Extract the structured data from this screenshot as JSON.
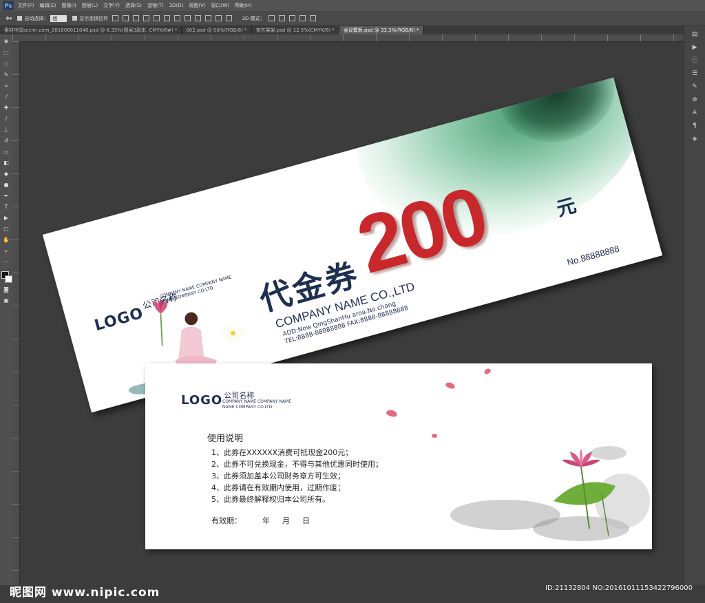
{
  "app": {
    "logo": "Ps"
  },
  "menu": [
    "文件(F)",
    "编辑(E)",
    "图像(I)",
    "图层(L)",
    "文字(Y)",
    "选择(S)",
    "滤镜(T)",
    "3D(D)",
    "视图(V)",
    "窗口(W)",
    "帮助(H)"
  ],
  "options": {
    "auto_select_label": "自动选择：",
    "auto_select_value": "组",
    "show_transform_label": "显示变换控件",
    "mode_3d_label": "3D 模式："
  },
  "tabs": [
    {
      "label": "素材中国sccnn.com_20160801104​8.psd @ 8.33%(图层3副本, CMYK/8#) *",
      "active": false
    },
    {
      "label": "002.psd @ 50%(RGB/8) *",
      "active": false
    },
    {
      "label": "茶艺展架.psd @ 12.5%(CMYK/8) *",
      "active": false
    },
    {
      "label": "会议模板.psd @ 33.3%(RGB/8) *",
      "active": true
    }
  ],
  "voucher_front": {
    "logo": "LOGO",
    "company_cn": "公司名称",
    "company_en_small": [
      "COMPANY NAME COMPANY NAME",
      "NAME COMPANY CO.LTD"
    ],
    "title": "代金券",
    "amount": "200",
    "unit": "元",
    "company_en": "COMPANY NAME CO.,LTD",
    "address": "ADD:Now QingShanHu aroa.No.chang",
    "contact": "TEL:8888-88888888  FAX:8888-88888888",
    "serial": "No.88888888"
  },
  "voucher_back": {
    "logo": "LOGO",
    "company_cn": "公司名称",
    "company_en_small": [
      "COMPANY NAME COMPANY NAME",
      "NAME COMPANY CO.LTD"
    ],
    "instructions_title": "使用说明",
    "instructions": [
      "1、此券在XXXXXX消费可抵现金200元；",
      "2、此券不可兑换现金，不得与其他优惠同时使用；",
      "3、此券须加盖本公司财务章方可生效；",
      "4、此券请在有效期内使用，过期作废；",
      "5、此券最终解释权归本公司所有。"
    ],
    "validity_label": "有效期：",
    "year": "年",
    "month": "月",
    "day": "日"
  },
  "watermark": {
    "left": "昵图网 www.nipic.com",
    "right": "ID:21132804 NO:20161011153422796000"
  },
  "colors": {
    "navy": "#1f2f52",
    "red": "#c8282c",
    "ink_green": "#2f8f5e"
  }
}
